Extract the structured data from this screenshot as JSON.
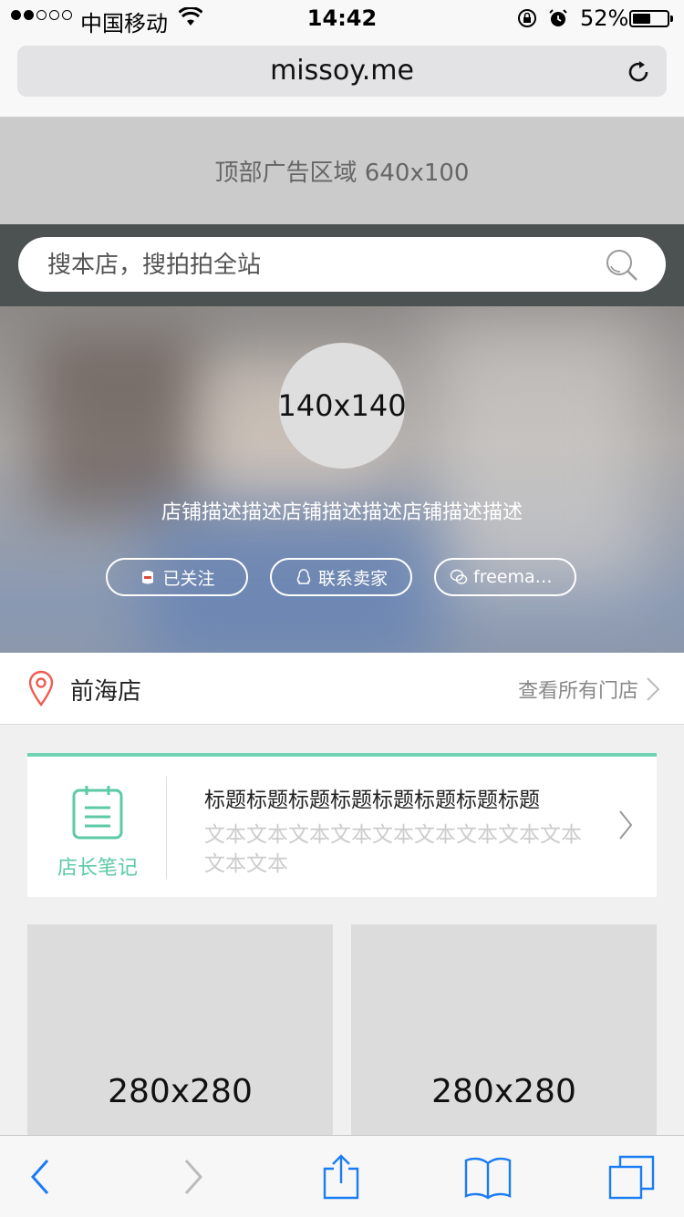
{
  "status_bar": {
    "carrier": "中国移动",
    "time": "14:42",
    "battery_percent": "52%",
    "battery_level": 0.52
  },
  "browser": {
    "url": "missoy.me"
  },
  "ad": {
    "label": "顶部广告区域 640x100"
  },
  "search": {
    "placeholder": "搜本店，搜拍拍全站"
  },
  "shop": {
    "avatar_label": "140x140",
    "description": "店铺描述描述店铺描述描述店铺描述描述",
    "buttons": {
      "follow": "已关注",
      "contact": "联系卖家",
      "wechat": "freemanf..."
    }
  },
  "store": {
    "name": "前海店",
    "view_all": "查看所有门店"
  },
  "notes": {
    "label": "店长笔记",
    "title": "标题标题标题标题标题标题标题标题",
    "text": "文本文本文本文本文本文本文本文本文本文本文本"
  },
  "products": [
    {
      "label": "280x280"
    },
    {
      "label": "280x280"
    }
  ],
  "colors": {
    "accent": "#6fd4b4",
    "ios_blue": "#1a7cf5",
    "pin_red": "#ef5b4f"
  }
}
